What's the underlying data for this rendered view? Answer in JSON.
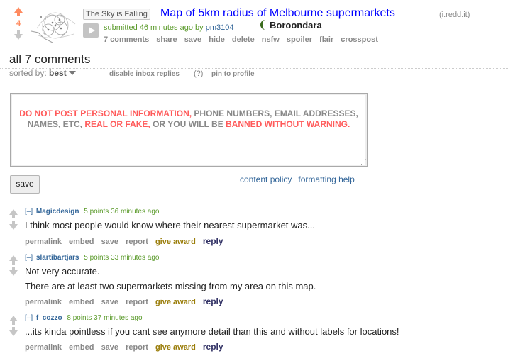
{
  "post": {
    "score": "4",
    "flair": "The Sky is Falling",
    "title": "Map of 5km radius of Melbourne supermarkets",
    "domain": "(i.redd.it)",
    "submitted": "submitted 46 minutes ago by",
    "author": "pm3104",
    "user_flair": "Boroondara",
    "buttons": [
      "7 comments",
      "share",
      "save",
      "hide",
      "delete",
      "nsfw",
      "spoiler",
      "flair",
      "crosspost"
    ]
  },
  "comments_area": {
    "title": "all 7 comments",
    "sorted_by_label": "sorted by:",
    "sort_value": "best",
    "disable_inbox": "disable inbox replies",
    "disable_inbox_help": "(?)",
    "pin": "pin to profile"
  },
  "editor": {
    "warning_part1": "DO NOT POST PERSONAL INFORMATION,",
    "warning_part2": " PHONE NUMBERS, EMAIL ADDRESSES,",
    "warning_part3": "NAMES, ETC, ",
    "warning_part4": "REAL OR FAKE,",
    "warning_part5": " OR YOU WILL BE ",
    "warning_part6": "BANNED WITHOUT WARNING.",
    "save_label": "save",
    "content_policy": "content policy",
    "formatting_help": "formatting help"
  },
  "comments": [
    {
      "toggle": "[–]",
      "author": "Magicdesign",
      "meta": "5 points 36 minutes ago",
      "lines": [
        "I think most people would know where their nearest supermarket was..."
      ],
      "buttons": [
        "permalink",
        "embed",
        "save",
        "report",
        "give award",
        "reply"
      ]
    },
    {
      "toggle": "[–]",
      "author": "slartibartjars",
      "meta": "5 points 33 minutes ago",
      "lines": [
        "Not very accurate.",
        "There are at least two supermarkets missing from my area on this map."
      ],
      "buttons": [
        "permalink",
        "embed",
        "save",
        "report",
        "give award",
        "reply"
      ]
    },
    {
      "toggle": "[–]",
      "author": "f_cozzo",
      "meta": "8 points 37 minutes ago",
      "lines": [
        "...its kinda pointless if you cant see anymore detail than this and without labels for locations!"
      ],
      "buttons": [
        "permalink",
        "embed",
        "save",
        "report",
        "give award",
        "reply"
      ]
    }
  ],
  "icons": [
    "upvote-arrow-icon",
    "downvote-arrow-icon",
    "play-icon",
    "caret-down-icon",
    "user-flair-icon",
    "resize-grip-icon"
  ],
  "colors": {
    "link": "#0000ff",
    "upvote": "#ff8b60",
    "warning_red": "#ff5a5a",
    "meta_blue": "#336699"
  }
}
